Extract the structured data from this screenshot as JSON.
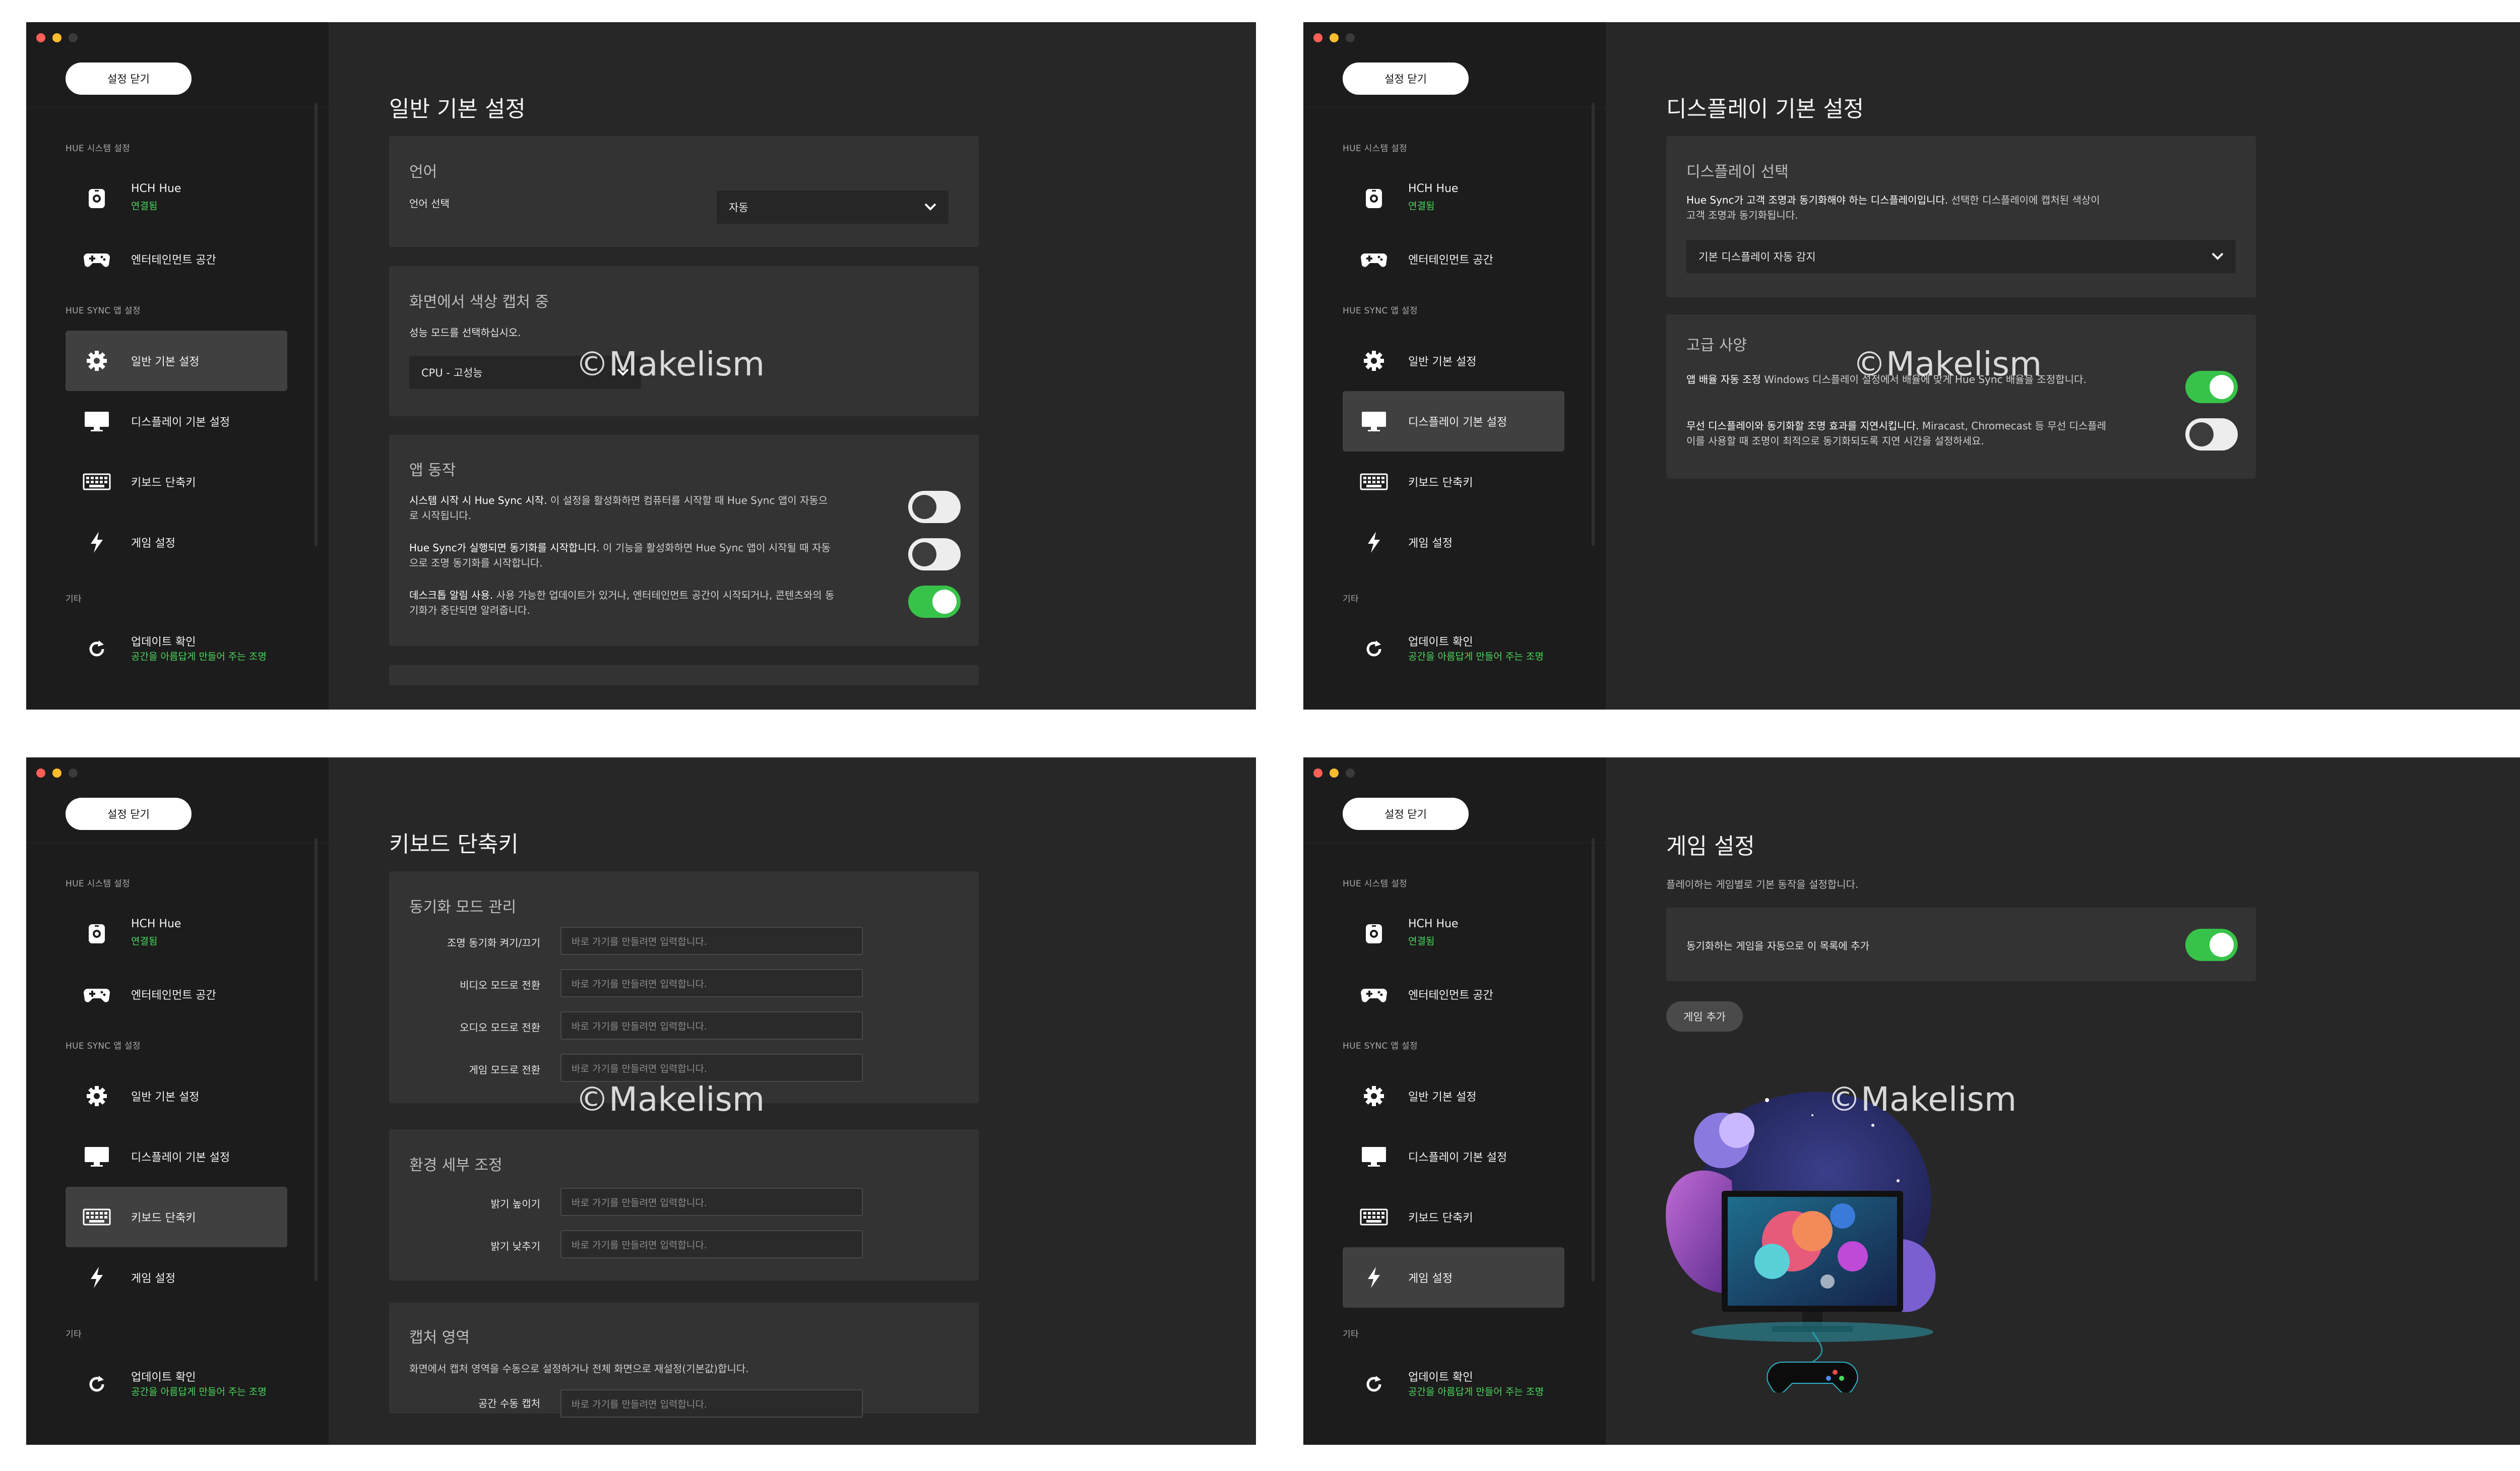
{
  "common": {
    "close_settings": "설정 닫기",
    "sections": {
      "hue_system": "HUE 시스템 설정",
      "hue_sync": "HUE SYNC 앱 설정",
      "other": "기타"
    },
    "nav": {
      "bridge_name": "HCH Hue",
      "bridge_status": "연결됨",
      "entertainment": "엔터테인먼트 공간",
      "general": "일반 기본 설정",
      "display": "디스플레이 기본 설정",
      "keyboard": "키보드 단축키",
      "game": "게임 설정",
      "update": "업데이트 확인",
      "update_sub": "공간을 아름답게 만들어 주는 조명"
    },
    "watermark": "©Makelism",
    "colors": {
      "accent_green": "#37c349",
      "status_green": "#4cd85c",
      "sidebar_bg": "#1c1c1c",
      "content_bg": "#272727",
      "card_bg": "#333333"
    },
    "icons": [
      "bridge-icon",
      "gamepad-icon",
      "gear-icon",
      "monitor-icon",
      "keyboard-icon",
      "bolt-icon",
      "refresh-icon"
    ]
  },
  "general": {
    "title": "일반 기본 설정",
    "language_card": {
      "title": "언어",
      "label": "언어 선택",
      "value": "자동"
    },
    "capture_card": {
      "title": "화면에서 색상 캡처 중",
      "label": "성능 모드를 선택하십시오.",
      "value": "CPU - 고성능"
    },
    "app_card": {
      "title": "앱 동작",
      "rows": [
        {
          "bold": "시스템 시작 시 Hue Sync 시작.",
          "text1": " 이 설정을 활성화하면 컴퓨터를 시작할 때 Hue Sync 앱이 자동으",
          "text2": "로 시작됩니다.",
          "on": false
        },
        {
          "bold": "Hue Sync가 실행되면 동기화를 시작합니다.",
          "text1": " 이 기능을 활성화하면 Hue Sync 앱이 시작될 때 자동",
          "text2": "으로 조명 동기화를 시작합니다.",
          "on": false
        },
        {
          "bold": "데스크톱 알림 사용.",
          "text1": " 사용 가능한 업데이트가 있거나, 엔터테인먼트 공간이 시작되거나, 콘텐츠와의 동",
          "text2": "기화가 중단되면 알려줍니다.",
          "on": true
        }
      ]
    }
  },
  "display": {
    "title": "디스플레이 기본 설정",
    "select_card": {
      "title": "디스플레이 선택",
      "bold": "Hue Sync가 고객 조명과 동기화해야 하는 디스플레이입니다.",
      "text1": " 선택한 디스플레이에 캡처된 색상이",
      "text2": "고객 조명과 동기화됩니다.",
      "value": "기본 디스플레이 자동 감지"
    },
    "advanced_card": {
      "title": "고급 사양",
      "rows": [
        {
          "bold": "앱 배율 자동 조정",
          "text1": " Windows 디스플레이 설정에서 배율에 맞게 Hue Sync 배율을 조정합니다.",
          "text2": "",
          "on": true
        },
        {
          "bold": "무선 디스플레이와 동기화할 조명 효과를 지연시킵니다.",
          "text1": " Miracast, Chromecast 등 무선 디스플레",
          "text2": "이를 사용할 때 조명이 최적으로 동기화되도록 지연 시간을 설정하세요.",
          "on": false
        }
      ]
    }
  },
  "keyboard": {
    "title": "키보드 단축키",
    "placeholder": "바로 가기를 만들려면 입력합니다.",
    "sync_card": {
      "title": "동기화 모드 관리",
      "rows": [
        "조명 동기화 켜기/끄기",
        "비디오 모드로 전환",
        "오디오 모드로 전환",
        "게임 모드로 전환"
      ]
    },
    "env_card": {
      "title": "환경 세부 조정",
      "rows": [
        "밝기 높이기",
        "밝기 낮추기"
      ]
    },
    "capture_card": {
      "title": "캡처 영역",
      "desc": "화면에서 캡처 영역을 수동으로 설정하거나 전체 화면으로 재설정(기본값)합니다.",
      "rows": [
        "공간 수동 캡처"
      ]
    }
  },
  "game": {
    "title": "게임 설정",
    "desc": "플레이하는 게임별로 기본 동작을 설정합니다.",
    "auto_add": {
      "label": "동기화하는 게임을 자동으로 이 목록에 추가",
      "on": true
    },
    "add_button": "게임 추가"
  }
}
